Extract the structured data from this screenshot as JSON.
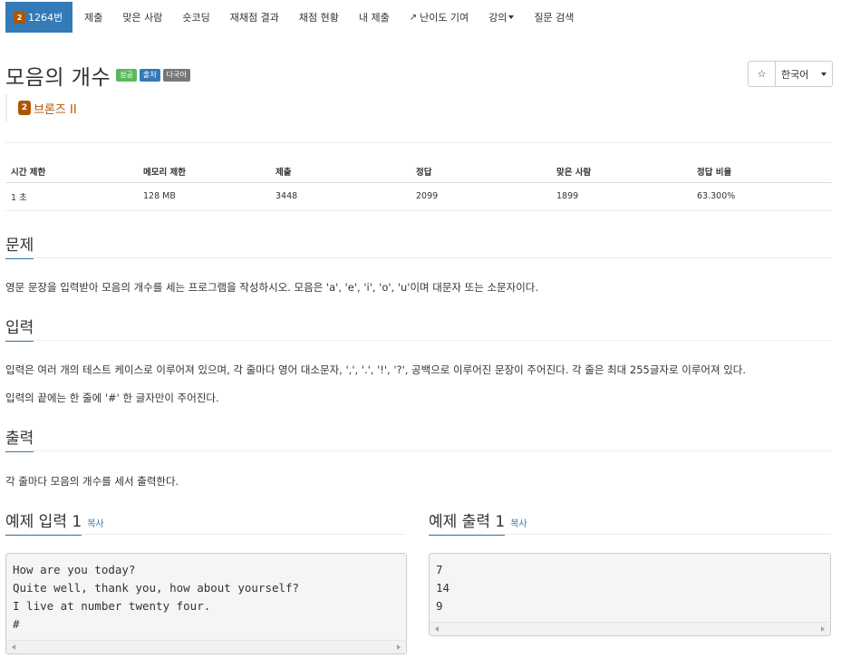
{
  "nav": {
    "active": {
      "tier": "2",
      "label": "1264번"
    },
    "items": [
      "제출",
      "맞은 사람",
      "숏코딩",
      "재채점 결과",
      "채점 현황",
      "내 제출",
      "난이도 기여",
      "강의",
      "질문 검색"
    ]
  },
  "problem": {
    "title": "모음의 개수",
    "labels": [
      "성공",
      "출처",
      "다국어"
    ],
    "tier_number": "2",
    "tier_text": "브론즈 II"
  },
  "controls": {
    "star": "☆",
    "language": "한국어"
  },
  "info": {
    "headers": [
      "시간 제한",
      "메모리 제한",
      "제출",
      "정답",
      "맞은 사람",
      "정답 비율"
    ],
    "values": [
      "1 초",
      "128 MB",
      "3448",
      "2099",
      "1899",
      "63.300%"
    ]
  },
  "sections": {
    "problem_title": "문제",
    "problem_text": "영문 문장을 입력받아 모음의 개수를 세는 프로그램을 작성하시오. 모음은 'a', 'e', 'i', 'o', 'u'이며 대문자 또는 소문자이다.",
    "input_title": "입력",
    "input_text_1": "입력은 여러 개의 테스트 케이스로 이루어져 있으며, 각 줄마다 영어 대소문자, ',', '.', '!', '?', 공백으로 이루어진 문장이 주어진다. 각 줄은 최대 255글자로 이루어져 있다.",
    "input_text_2": "입력의 끝에는 한 줄에 '#' 한 글자만이 주어진다.",
    "output_title": "출력",
    "output_text": "각 줄마다 모음의 개수를 세서 출력한다."
  },
  "samples": {
    "input_title": "예제 입력 1",
    "output_title": "예제 출력 1",
    "copy": "복사",
    "input": "How are you today?\nQuite well, thank you, how about yourself?\nI live at number twenty four.\n#",
    "output": "7\n14\n9"
  }
}
